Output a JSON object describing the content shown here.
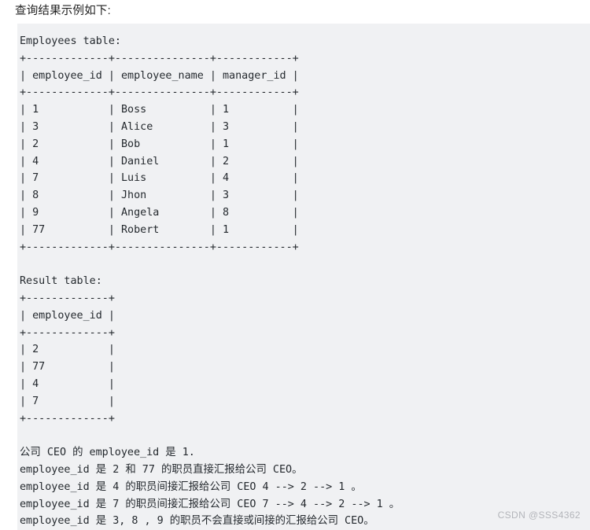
{
  "page": {
    "title": "查询结果示例如下:",
    "background_color": "#ffffff",
    "code_block_color": "#f0f1f3",
    "text_color": "#24292e"
  },
  "code_block": {
    "employees_table": {
      "caption": "Employees table:",
      "separator": "+-------------+---------------+------------+",
      "header_row": "| employee_id | employee_name | manager_id |",
      "columns": [
        "employee_id",
        "employee_name",
        "manager_id"
      ],
      "rows": [
        "| 1           | Boss          | 1          |",
        "| 3           | Alice         | 3          |",
        "| 2           | Bob           | 1          |",
        "| 4           | Daniel        | 2          |",
        "| 7           | Luis          | 4          |",
        "| 8           | Jhon          | 3          |",
        "| 9           | Angela        | 8          |",
        "| 77          | Robert        | 1          |"
      ],
      "row_values": [
        {
          "employee_id": "1",
          "employee_name": "Boss",
          "manager_id": "1"
        },
        {
          "employee_id": "3",
          "employee_name": "Alice",
          "manager_id": "3"
        },
        {
          "employee_id": "2",
          "employee_name": "Bob",
          "manager_id": "1"
        },
        {
          "employee_id": "4",
          "employee_name": "Daniel",
          "manager_id": "2"
        },
        {
          "employee_id": "7",
          "employee_name": "Luis",
          "manager_id": "4"
        },
        {
          "employee_id": "8",
          "employee_name": "Jhon",
          "manager_id": "3"
        },
        {
          "employee_id": "9",
          "employee_name": "Angela",
          "manager_id": "8"
        },
        {
          "employee_id": "77",
          "employee_name": "Robert",
          "manager_id": "1"
        }
      ]
    },
    "result_table": {
      "caption": "Result table:",
      "separator": "+-------------+",
      "header_row": "| employee_id |",
      "columns": [
        "employee_id"
      ],
      "rows": [
        "| 2           |",
        "| 77          |",
        "| 4           |",
        "| 7           |"
      ],
      "row_values": [
        {
          "employee_id": "2"
        },
        {
          "employee_id": "77"
        },
        {
          "employee_id": "4"
        },
        {
          "employee_id": "7"
        }
      ]
    },
    "explanation": [
      "公司 CEO 的 employee_id 是 1.",
      "employee_id 是 2 和 77 的职员直接汇报给公司 CEO。",
      "employee_id 是 4 的职员间接汇报给公司 CEO 4 --> 2 --> 1 。",
      "employee_id 是 7 的职员间接汇报给公司 CEO 7 --> 4 --> 2 --> 1 。",
      "employee_id 是 3, 8 , 9 的职员不会直接或间接的汇报给公司 CEO。"
    ]
  },
  "watermark": {
    "text": "CSDN @SSS4362"
  }
}
